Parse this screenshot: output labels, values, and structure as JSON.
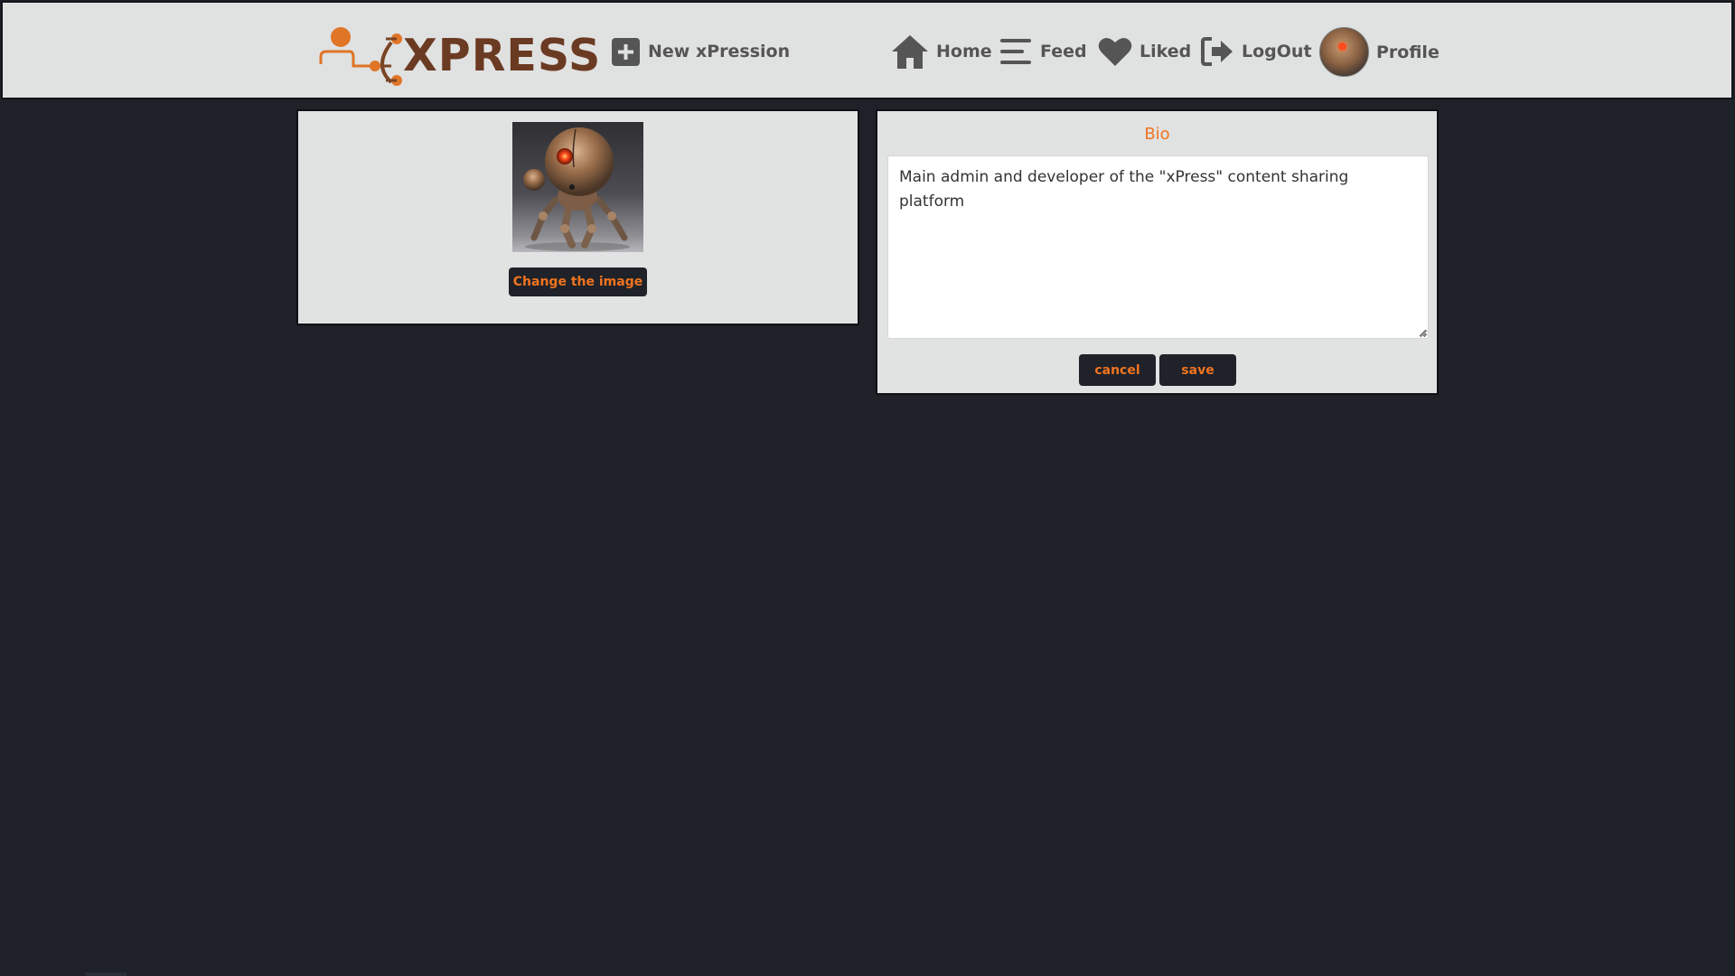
{
  "brand": {
    "logo_text": "XPRESS",
    "accent_color": "#f0741f",
    "logo_color": "#6b3a22",
    "icon": "person-node-logo-icon"
  },
  "nav": {
    "new_expression": {
      "label": "New xPression",
      "icon": "plus-square-icon"
    },
    "home": {
      "label": "Home",
      "icon": "home-icon"
    },
    "feed": {
      "label": "Feed",
      "icon": "bars-icon"
    },
    "liked": {
      "label": "Liked",
      "icon": "heart-icon"
    },
    "logout": {
      "label": "LogOut",
      "icon": "sign-out-icon"
    },
    "profile": {
      "label": "Profile",
      "icon": "avatar"
    }
  },
  "image_panel": {
    "change_image_label": "Change the image"
  },
  "bio_panel": {
    "title": "Bio",
    "text": "Main admin and developer of the \"xPress\" content sharing platform",
    "cancel_label": "cancel",
    "save_label": "save"
  },
  "colors": {
    "page_background": "#1e2128",
    "panel_background": "#e1e2e2",
    "button_background": "#1f2229",
    "nav_text": "#555555"
  }
}
